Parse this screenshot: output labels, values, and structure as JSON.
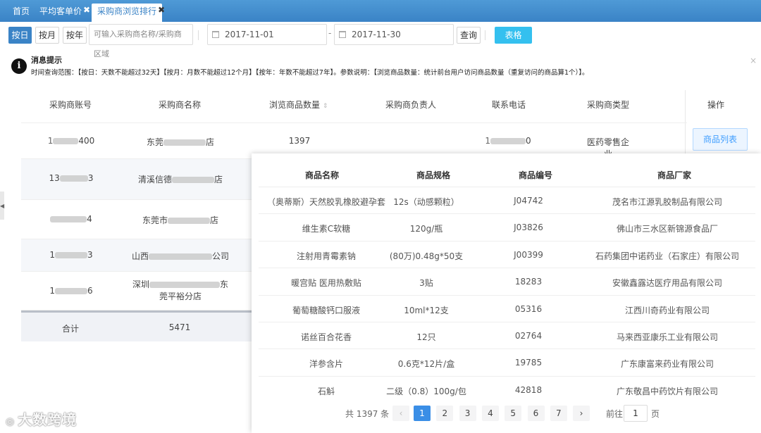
{
  "tabs": [
    {
      "label": "首页"
    },
    {
      "label": "平均客单价"
    },
    {
      "label": "采购商浏览排行"
    }
  ],
  "toolbar": {
    "by_day": "按日",
    "by_month": "按月",
    "by_year": "按年",
    "search_placeholder": "可输入采购商名称/采购商区域",
    "start_date": "2017-11-01",
    "end_date": "2017-11-30",
    "date_sep": "-",
    "query": "查询",
    "table": "表格"
  },
  "message": {
    "title": "消息提示",
    "text": "时间查询范围：【按日：天数不能超过32天】【按月：月数不能超过12个月】【按年：年数不能超过7年】。参数说明：【浏览商品数量：统计前台用户访问商品数量（重复访问的商品算1个）】。"
  },
  "table": {
    "headers": [
      "采购商账号",
      "采购商名称",
      "浏览商品数量",
      "采购商负责人",
      "联系电话",
      "采购商类型",
      "操作"
    ],
    "rows": [
      {
        "account_suffix": "400",
        "name_prefix": "东莞",
        "name_suffix": "店",
        "count": "1397",
        "phone_suffix": "0",
        "type": "医药零售企业",
        "action": "商品列表"
      },
      {
        "account_prefix": "13",
        "account_suffix": "3",
        "name_prefix": "清溪信德",
        "name_suffix": "店"
      },
      {
        "account_suffix": "4",
        "name_prefix": "东莞市",
        "name_suffix": "店"
      },
      {
        "account_prefix": "1",
        "account_suffix": "3",
        "name_prefix": "山西",
        "name_suffix": "公司"
      },
      {
        "account_prefix": "1",
        "account_suffix": "6",
        "name_prefix": "深圳",
        "name_suffix": "东",
        "name_line2": "莞平裕分店"
      }
    ],
    "total_label": "合计",
    "total_value": "5471"
  },
  "popup": {
    "headers": [
      "商品名称",
      "商品规格",
      "商品编号",
      "商品厂家"
    ],
    "rows": [
      [
        "（奥蒂斯）天然胶乳橡胶避孕套",
        "12s（动感颗粒）",
        "J04742",
        "茂名市江源乳胶制品有限公司"
      ],
      [
        "维生素C软糖",
        "120g/瓶",
        "J03826",
        "佛山市三水区新锦源食品厂"
      ],
      [
        "注射用青霉素钠",
        "(80万)0.48g*50支",
        "J00399",
        "石药集团中诺药业（石家庄）有限公司"
      ],
      [
        "暖宫贴 医用热敷贴",
        "3贴",
        "18283",
        "安徽鑫露达医疗用品有限公司"
      ],
      [
        "葡萄糖酸钙口服液",
        "10ml*12支",
        "05316",
        "江西川奇药业有限公司"
      ],
      [
        "诺丝百合花香",
        "12只",
        "02764",
        "马来西亚康乐工业有限公司"
      ],
      [
        "洋参含片",
        "0.6克*12片/盒",
        "19785",
        "广东康富来药业有限公司"
      ],
      [
        "石斛",
        "二级（0.8）100g/包",
        "42818",
        "广东敬昌中药饮片有限公司"
      ]
    ],
    "pager": {
      "total": "共 1397 条",
      "prev": "‹",
      "pages": [
        "1",
        "2",
        "3",
        "4",
        "5",
        "6",
        "7"
      ],
      "next": "›",
      "goto_label": "前往",
      "goto_value": "1",
      "page_unit": "页"
    }
  },
  "watermark": "大数跨境"
}
